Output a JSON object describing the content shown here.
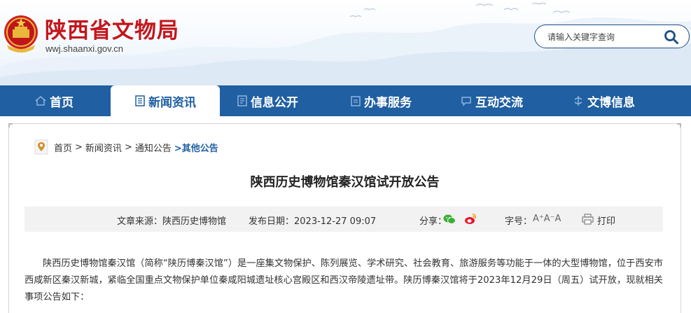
{
  "header": {
    "title": "陕西省文物局",
    "url": "wwj.shaanxi.gov.cn",
    "search_placeholder": "请输入关键字查询"
  },
  "nav": [
    {
      "label": "首页",
      "icon": "home-icon",
      "active": false
    },
    {
      "label": "新闻资讯",
      "icon": "news-icon",
      "active": true
    },
    {
      "label": "信息公开",
      "icon": "document-icon",
      "active": false
    },
    {
      "label": "办事服务",
      "icon": "service-icon",
      "active": false
    },
    {
      "label": "互动交流",
      "icon": "chat-icon",
      "active": false
    },
    {
      "label": "文博信息",
      "icon": "culture-icon",
      "active": false
    }
  ],
  "breadcrumb": {
    "items": [
      "首页",
      ">",
      "新闻资讯",
      ">",
      "通知公告",
      ">其他公告"
    ]
  },
  "article": {
    "title": "陕西历史博物馆秦汉馆试开放公告",
    "source": "文章来源：陕西历史博物馆",
    "date": "发布日期：2023-12-27 09:07",
    "share_label": "分享：",
    "font_label": "字号：",
    "font_sizes": "A⁺A⁻A",
    "print_label": "打印",
    "paragraph": "陕西历史博物馆秦汉馆（简称“陕历博秦汉馆”）是一座集文物保护、陈列展览、学术研究、社会教育、旅游服务等功能于一体的大型博物馆，位于西安市西咸新区秦汉新城，紧临全国重点文物保护单位秦咸阳城遗址核心宫殿区和西汉帝陵遗址带。陕历博秦汉馆将于2023年12月29日（周五）试开放，现就相关事项公告如下："
  },
  "colors": {
    "brand_red": "#c4161c",
    "nav_blue": "#1f5fa2"
  }
}
